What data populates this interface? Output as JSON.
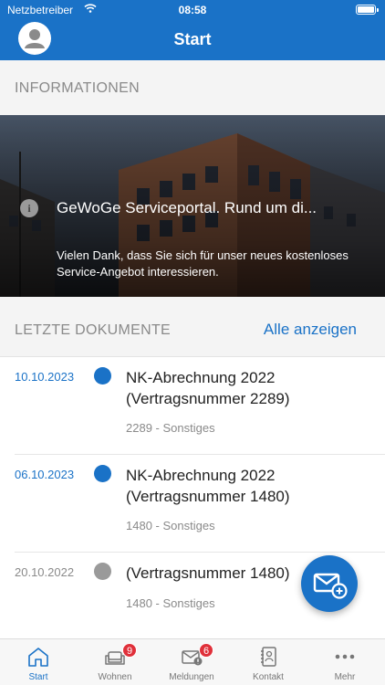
{
  "status_bar": {
    "carrier": "Netzbetreiber",
    "time": "08:58"
  },
  "header": {
    "title": "Start"
  },
  "info_section": {
    "label": "INFORMATIONEN",
    "card": {
      "title": "GeWoGe Serviceportal. Rund um di...",
      "description": "Vielen Dank, dass Sie sich für unser neues kostenloses Service-Angebot interessieren."
    }
  },
  "documents_section": {
    "label": "LETZTE DOKUMENTE",
    "show_all": "Alle anzeigen",
    "items": [
      {
        "date": "10.10.2023",
        "title": "NK-Abrechnung 2022 (Vertragsnummer 2289)",
        "meta": "2289 - Sonstiges",
        "status_color": "#1a72c7",
        "date_color": "#1a72c7"
      },
      {
        "date": "06.10.2023",
        "title": "NK-Abrechnung 2022 (Vertragsnummer 1480)",
        "meta": "1480 - Sonstiges",
        "status_color": "#1a72c7",
        "date_color": "#1a72c7"
      },
      {
        "date": "20.10.2022",
        "title": "(Vertragsnummer 1480)",
        "meta": "1480 - Sonstiges",
        "status_color": "#9a9a9a",
        "date_color": "#8a8a8a"
      }
    ]
  },
  "fab": {
    "icon": "mail-add-icon"
  },
  "tabbar": {
    "tabs": [
      {
        "label": "Start",
        "icon": "home-icon",
        "active": true
      },
      {
        "label": "Wohnen",
        "icon": "sofa-icon",
        "badge": "9"
      },
      {
        "label": "Meldungen",
        "icon": "mail-alert-icon",
        "badge": "6"
      },
      {
        "label": "Kontakt",
        "icon": "contacts-book-icon"
      },
      {
        "label": "Mehr",
        "icon": "more-dots-icon"
      }
    ]
  },
  "colors": {
    "accent": "#1a72c7",
    "badge": "#e0303a"
  }
}
